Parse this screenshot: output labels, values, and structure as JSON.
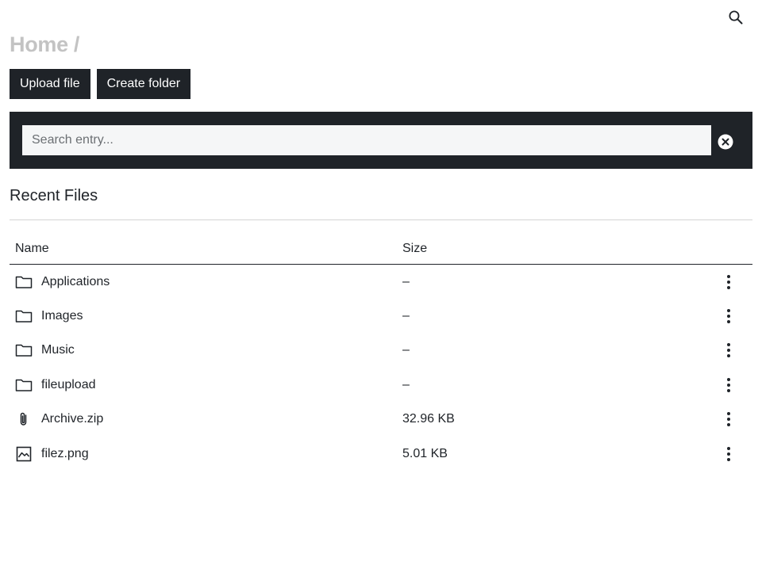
{
  "header": {
    "search_icon": "search-icon"
  },
  "breadcrumb": {
    "home": "Home",
    "separator": "/"
  },
  "actions": {
    "upload_label": "Upload file",
    "create_folder_label": "Create folder"
  },
  "search": {
    "placeholder": "Search entry...",
    "value": "",
    "clear_icon": "close-circle-icon"
  },
  "section": {
    "title": "Recent Files"
  },
  "table": {
    "headers": {
      "name": "Name",
      "size": "Size"
    },
    "rows": [
      {
        "name": "Applications",
        "size": "–",
        "icon": "folder-icon"
      },
      {
        "name": "Images",
        "size": "–",
        "icon": "folder-icon"
      },
      {
        "name": "Music",
        "size": "–",
        "icon": "folder-icon"
      },
      {
        "name": "fileupload",
        "size": "–",
        "icon": "folder-icon"
      },
      {
        "name": "Archive.zip",
        "size": "32.96 KB",
        "icon": "paperclip-icon"
      },
      {
        "name": "filez.png",
        "size": "5.01 KB",
        "icon": "image-icon"
      }
    ]
  },
  "colors": {
    "dark": "#1f2328",
    "muted": "#c3c3c3",
    "input_bg": "#f5f6f7"
  }
}
